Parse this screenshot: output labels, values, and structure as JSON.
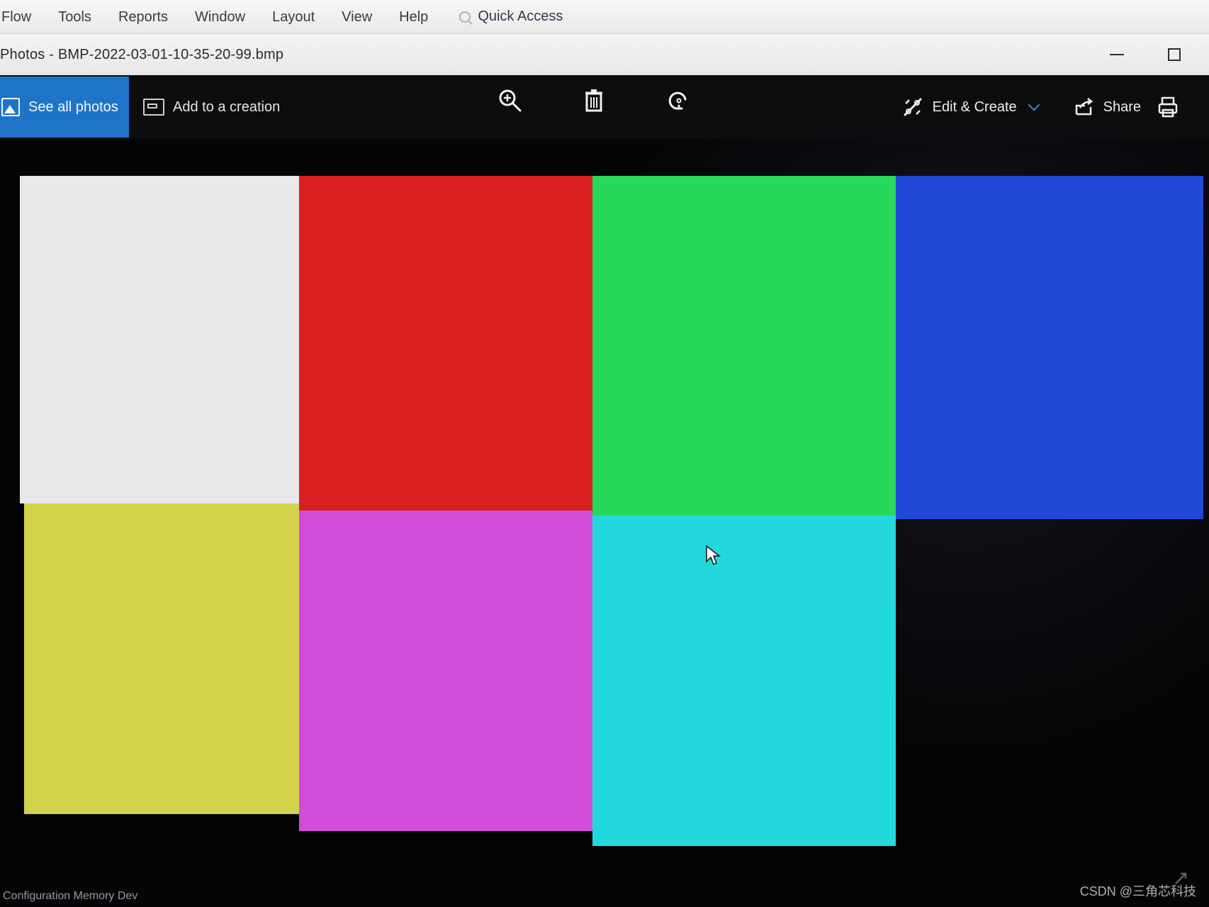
{
  "menubar": {
    "items": [
      "Flow",
      "Tools",
      "Reports",
      "Window",
      "Layout",
      "View",
      "Help"
    ],
    "quick_access_label": "Quick Access"
  },
  "photos_window": {
    "title": "Photos - BMP-2022-03-01-10-35-20-99.bmp",
    "toolbar": {
      "see_all_photos_label": "See all photos",
      "add_to_creation_label": "Add to a creation",
      "edit_create_label": "Edit & Create",
      "share_label": "Share"
    }
  },
  "viewer": {
    "color_blocks": [
      {
        "name": "white",
        "color": "#e6e8ea"
      },
      {
        "name": "red",
        "color": "#d91f1f"
      },
      {
        "name": "green",
        "color": "#27d95a"
      },
      {
        "name": "blue",
        "color": "#2149d6"
      },
      {
        "name": "yellow",
        "color": "#d3d24a"
      },
      {
        "name": "magenta",
        "color": "#d24cda"
      },
      {
        "name": "cyan",
        "color": "#23d8dd"
      }
    ]
  },
  "bottom": {
    "status_text": "Configuration Memory Dev",
    "watermark": "CSDN @三角芯科技"
  },
  "colors": {
    "accent": "#1f74c9",
    "toolbar_bg": "#0d0d10",
    "viewer_bg": "#050507"
  }
}
